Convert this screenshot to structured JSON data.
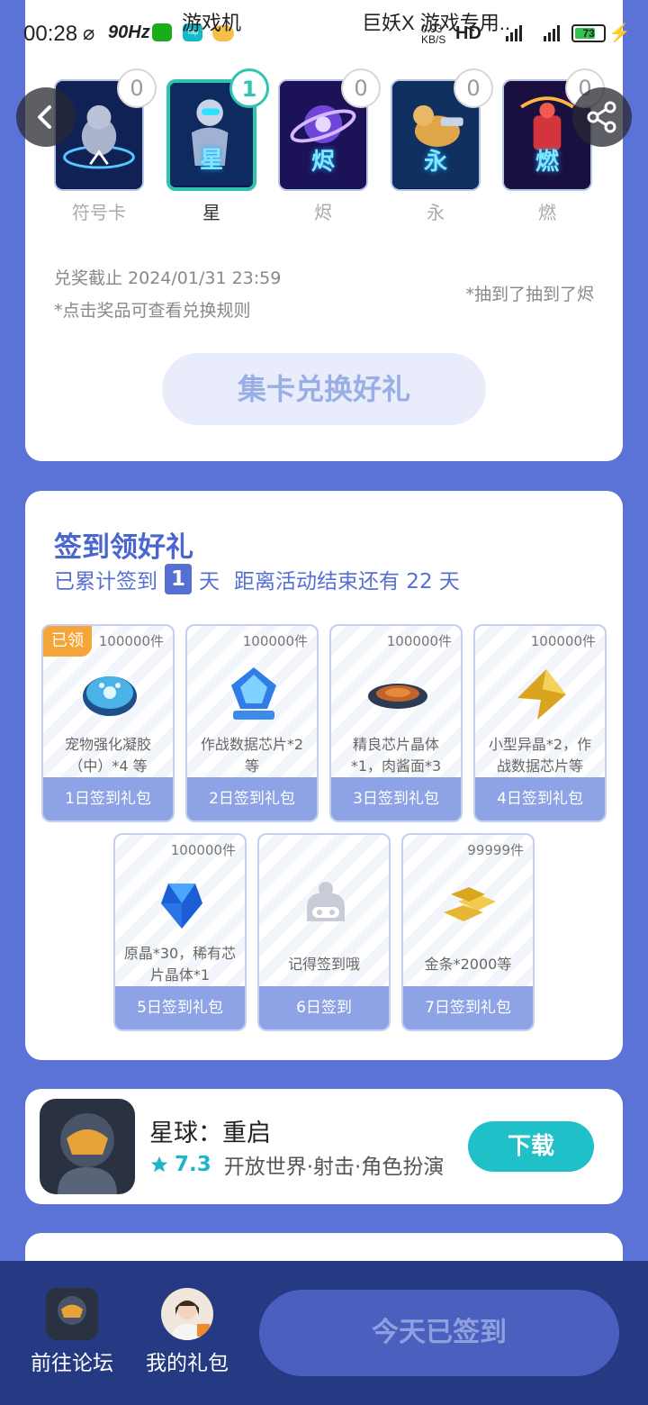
{
  "status_bar": {
    "time": "00:28",
    "refresh_rate": "90Hz",
    "overlay_left": "游戏机",
    "overlay_right": "巨妖X 游戏专用..",
    "net_speed": "0.93 KB/S",
    "hd": "HD",
    "battery": "73",
    "battery_fraction": 0.73
  },
  "cards": [
    {
      "name": "符号卡",
      "char": "",
      "count": "0",
      "selected": false
    },
    {
      "name": "星",
      "char": "星",
      "count": "1",
      "selected": true
    },
    {
      "name": "烬",
      "char": "烬",
      "count": "0",
      "selected": false
    },
    {
      "name": "永",
      "char": "永",
      "count": "0",
      "selected": false
    },
    {
      "name": "燃",
      "char": "燃",
      "count": "0",
      "selected": false
    }
  ],
  "exchange": {
    "deadline": "兑奖截止 2024/01/31 23:59",
    "rule_tip": "*点击奖品可查看兑换规则",
    "drawn_tip": "*抽到了抽到了烬",
    "button": "集卡兑换好礼"
  },
  "checkin": {
    "title": "签到领好礼",
    "sub_prefix": "已累计签到",
    "days": "1",
    "sub_day": "天",
    "sub_suffix": "距离活动结束还有 22 天",
    "claimed_badge": "已领",
    "gifts": [
      {
        "qty": "100000件",
        "desc": "宠物强化凝胶（中）*4 等",
        "label": "1日签到礼包",
        "icon": "gel-icon"
      },
      {
        "qty": "100000件",
        "desc": "作战数据芯片*2等",
        "label": "2日签到礼包",
        "icon": "chip-icon"
      },
      {
        "qty": "100000件",
        "desc": "精良芯片晶体*1，肉酱面*3",
        "label": "3日签到礼包",
        "icon": "noodle-icon"
      },
      {
        "qty": "100000件",
        "desc": "小型异晶*2，作战数据芯片等",
        "label": "4日签到礼包",
        "icon": "crystal-icon"
      },
      {
        "qty": "100000件",
        "desc": "原晶*30，稀有芯片晶体*1",
        "label": "5日签到礼包",
        "icon": "gem-icon"
      },
      {
        "qty": "",
        "desc": "记得签到哦",
        "label": "6日签到",
        "icon": "mascot-icon"
      },
      {
        "qty": "99999件",
        "desc": "金条*2000等",
        "label": "7日签到礼包",
        "icon": "gold-bar-icon"
      }
    ]
  },
  "game": {
    "name": "星球：重启",
    "rating": "7.3",
    "tags": "开放世界·射击·角色扮演",
    "download": "下载"
  },
  "bottom": {
    "forum": "前往论坛",
    "my_gifts": "我的礼包",
    "checked_in": "今天已签到"
  }
}
